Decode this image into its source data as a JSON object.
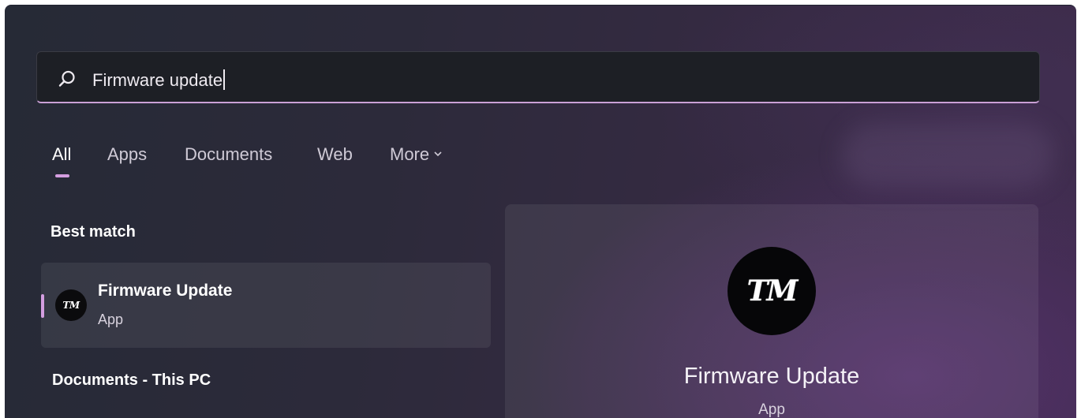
{
  "search": {
    "value": "Firmware update",
    "icon": "search-icon"
  },
  "tabs": [
    {
      "label": "All",
      "active": true
    },
    {
      "label": "Apps"
    },
    {
      "label": "Documents"
    },
    {
      "label": "Web"
    },
    {
      "label": "More",
      "icon": "chevron-down-icon"
    }
  ],
  "sections": {
    "best_match": "Best match",
    "documents": "Documents - This PC"
  },
  "best_match_item": {
    "name": "Firmware Update",
    "type": "App",
    "logo_text": "TM"
  },
  "preview": {
    "logo_text": "TM",
    "name": "Firmware Update",
    "type": "App"
  },
  "colors": {
    "accent": "#d49ee0",
    "search_bg": "#1d1f25",
    "panel_bg": "#2c2a3a"
  }
}
